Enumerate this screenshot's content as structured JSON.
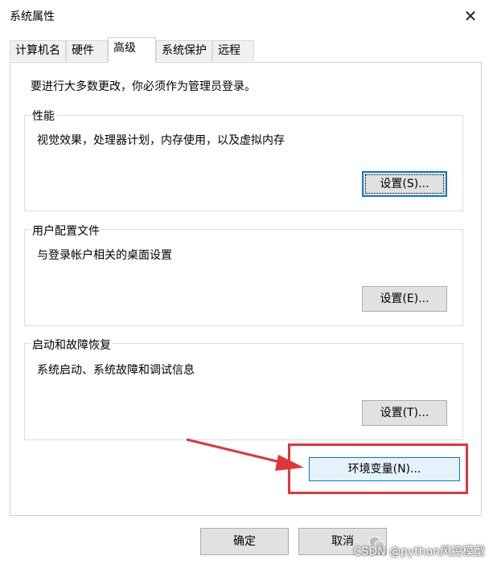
{
  "window": {
    "title": "系统属性",
    "close_glyph": "✕"
  },
  "tabs": [
    {
      "label": "计算机名",
      "active": false
    },
    {
      "label": "硬件",
      "active": false
    },
    {
      "label": "高级",
      "active": true
    },
    {
      "label": "系统保护",
      "active": false
    },
    {
      "label": "远程",
      "active": false
    }
  ],
  "advanced": {
    "admin_note": "要进行大多数更改，你必须作为管理员登录。",
    "performance": {
      "title": "性能",
      "description": "视觉效果，处理器计划，内存使用，以及虚拟内存",
      "button": "设置(S)..."
    },
    "user_profiles": {
      "title": "用户配置文件",
      "description": "与登录帐户相关的桌面设置",
      "button": "设置(E)..."
    },
    "startup_recovery": {
      "title": "启动和故障恢复",
      "description": "系统启动、系统故障和调试信息",
      "button": "设置(T)..."
    },
    "env_button": "环境变量(N)..."
  },
  "footer": {
    "ok": "确定",
    "cancel": "取消"
  },
  "watermark": {
    "text": "CSDN @python风控模型"
  },
  "annotation": {
    "color": "#e0353b"
  }
}
